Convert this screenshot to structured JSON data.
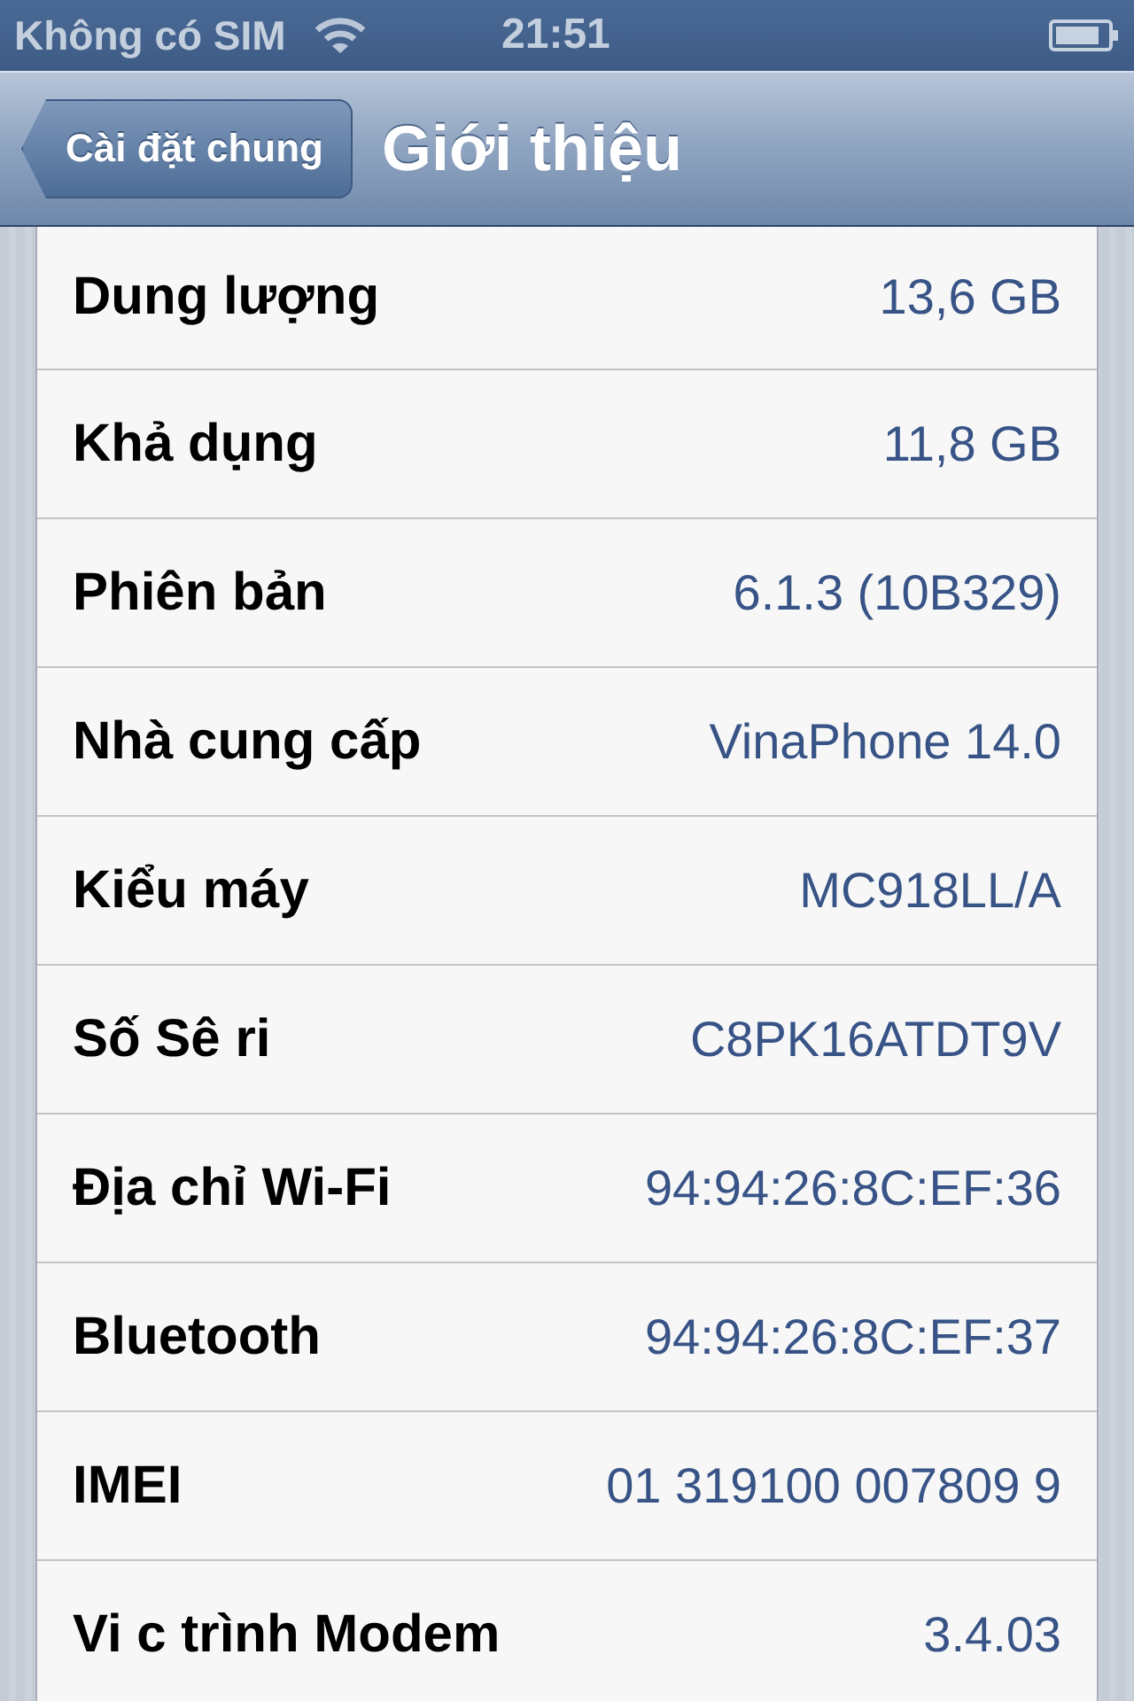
{
  "status_bar": {
    "carrier": "Không có SIM",
    "time": "21:51"
  },
  "nav_bar": {
    "back_button": "Cài đặt chung",
    "title": "Giới thiệu"
  },
  "rows": [
    {
      "label": "Dung lượng",
      "value": "13,6 GB"
    },
    {
      "label": "Khả dụng",
      "value": "11,8 GB"
    },
    {
      "label": "Phiên bản",
      "value": "6.1.3 (10B329)"
    },
    {
      "label": "Nhà cung cấp",
      "value": "VinaPhone 14.0"
    },
    {
      "label": "Kiểu máy",
      "value": "MC918LL/A"
    },
    {
      "label": "Số Sê ri",
      "value": "C8PK16ATDT9V"
    },
    {
      "label": "Địa chỉ Wi-Fi",
      "value": "94:94:26:8C:EF:36"
    },
    {
      "label": "Bluetooth",
      "value": "94:94:26:8C:EF:37"
    },
    {
      "label": "IMEI",
      "value": "01 319100 007809 9"
    },
    {
      "label": "Vi c trình Modem",
      "value": "3.4.03"
    }
  ]
}
